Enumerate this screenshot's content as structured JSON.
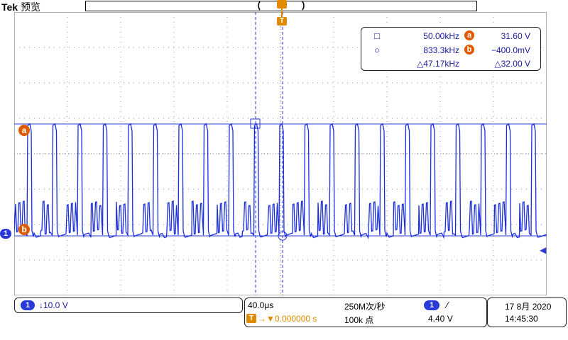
{
  "header": {
    "brand": "Tek",
    "mode": "预览"
  },
  "trigger_marker": "T",
  "cursors": {
    "rows": [
      {
        "symbol": "□",
        "freq": "50.00kHz",
        "label": "a",
        "value": "31.60 V"
      },
      {
        "symbol": "○",
        "freq": "833.3kHz",
        "label": "b",
        "value": "−400.0mV"
      },
      {
        "symbol": "",
        "freq": "△47.17kHz",
        "label": "",
        "value": "△32.00 V"
      }
    ]
  },
  "markers": {
    "a": "a",
    "b": "b",
    "ch1": "1"
  },
  "bottom": {
    "channel": {
      "num": "1",
      "scale": "↓10.0 V"
    },
    "timebase": "40.0μs",
    "trigger_pos": "0.000000 s",
    "sample_rate": "250M次/秒",
    "record_length": "100k 点",
    "trigger": {
      "channel": "1",
      "slope": "∕",
      "level": "4.40 V"
    },
    "date": "17 8月 2020",
    "time": "14:45:30"
  },
  "colors": {
    "trace": "#1a2ee0",
    "grid": "#9a9a9a",
    "cursor": "#2a3ad8",
    "trigger": "#e08a00",
    "label": "#e05a00"
  }
}
